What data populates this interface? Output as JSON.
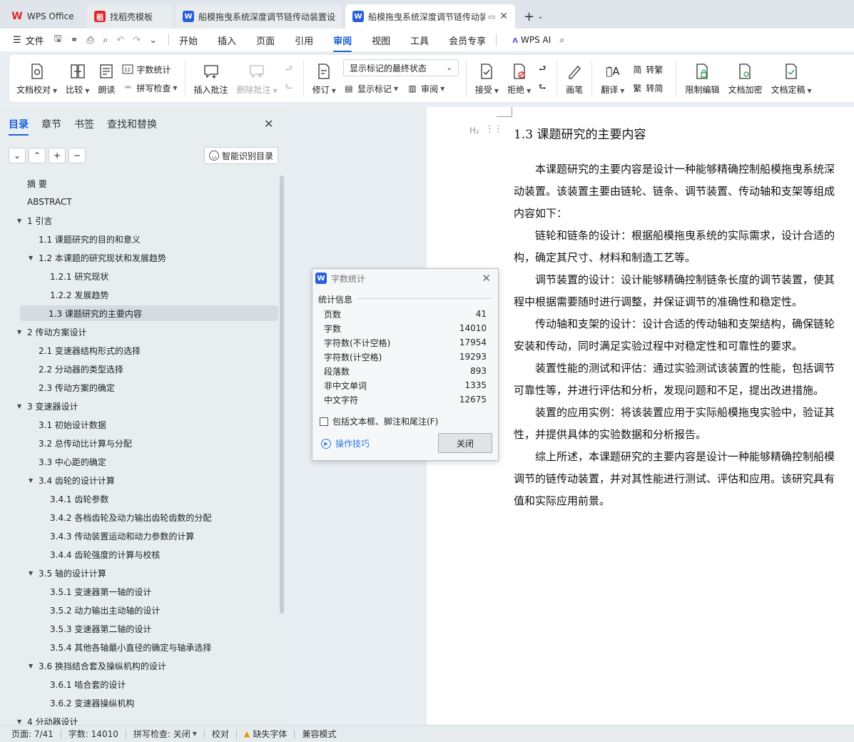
{
  "tabs": [
    {
      "label": "WPS Office"
    },
    {
      "label": "找稻壳模板"
    },
    {
      "label": "船模拖曳系统深度调节链传动装置设计"
    },
    {
      "label": "船模拖曳系统深度调节链传动装"
    }
  ],
  "menu": {
    "file": "文件",
    "nav": [
      "开始",
      "插入",
      "页面",
      "引用",
      "审阅",
      "视图",
      "工具",
      "会员专享"
    ],
    "ai": "WPS AI"
  },
  "ribbon": {
    "proof": "文档校对",
    "compare": "比较",
    "read": "朗读",
    "wordcount": "字数统计",
    "spell": "拼写检查",
    "insert_comment": "插入批注",
    "delete_comment": "删除批注",
    "revise": "修订",
    "markup_combo": "显示标记的最终状态",
    "show_markup": "显示标记",
    "review": "审阅",
    "accept": "接受",
    "reject": "拒绝",
    "pen": "画笔",
    "translate": "翻译",
    "to_trad": "转繁",
    "to_simp": "转简",
    "restrict": "限制编辑",
    "encrypt": "文档加密",
    "finalize": "文档定稿"
  },
  "navpane": {
    "tabs": [
      "目录",
      "章节",
      "书签",
      "查找和替换"
    ],
    "smart_toc": "智能识别目录",
    "toc": [
      {
        "label": "摘 要",
        "level": 0,
        "arrow": false
      },
      {
        "label": "ABSTRACT",
        "level": 0,
        "arrow": false
      },
      {
        "label": "1 引言",
        "level": 0,
        "arrow": true
      },
      {
        "label": "1.1 课题研究的目的和意义",
        "level": 1,
        "arrow": false
      },
      {
        "label": "1.2 本课题的研究现状和发展趋势",
        "level": 1,
        "arrow": true
      },
      {
        "label": "1.2.1 研究现状",
        "level": 2,
        "arrow": false
      },
      {
        "label": "1.2.2 发展趋势",
        "level": 2,
        "arrow": false
      },
      {
        "label": "1.3 课题研究的主要内容",
        "level": 1,
        "arrow": false,
        "selected": true
      },
      {
        "label": "2 传动方案设计",
        "level": 0,
        "arrow": true
      },
      {
        "label": "2.1 变速器结构形式的选择",
        "level": 1,
        "arrow": false
      },
      {
        "label": "2.2 分动器的类型选择",
        "level": 1,
        "arrow": false
      },
      {
        "label": "2.3 传动方案的确定",
        "level": 1,
        "arrow": false
      },
      {
        "label": "3 变速器设计",
        "level": 0,
        "arrow": true
      },
      {
        "label": "3.1 初始设计数据",
        "level": 1,
        "arrow": false
      },
      {
        "label": "3.2 总传动比计算与分配",
        "level": 1,
        "arrow": false
      },
      {
        "label": "3.3 中心距的确定",
        "level": 1,
        "arrow": false
      },
      {
        "label": "3.4 齿轮的设计计算",
        "level": 1,
        "arrow": true
      },
      {
        "label": "3.4.1 齿轮参数",
        "level": 2,
        "arrow": false
      },
      {
        "label": "3.4.2 各档齿轮及动力输出齿轮齿数的分配",
        "level": 2,
        "arrow": false
      },
      {
        "label": "3.4.3 传动装置运动和动力参数的计算",
        "level": 2,
        "arrow": false
      },
      {
        "label": "3.4.4 齿轮强度的计算与校核",
        "level": 2,
        "arrow": false
      },
      {
        "label": "3.5 轴的设计计算",
        "level": 1,
        "arrow": true
      },
      {
        "label": "3.5.1 变速器第一轴的设计",
        "level": 2,
        "arrow": false
      },
      {
        "label": "3.5.2 动力输出主动轴的设计",
        "level": 2,
        "arrow": false
      },
      {
        "label": "3.5.3 变速器第二轴的设计",
        "level": 2,
        "arrow": false
      },
      {
        "label": "3.5.4 其他各轴最小直径的确定与轴承选择",
        "level": 2,
        "arrow": false
      },
      {
        "label": "3.6 换挡结合套及操纵机构的设计",
        "level": 1,
        "arrow": true
      },
      {
        "label": "3.6.1 啮合套的设计",
        "level": 2,
        "arrow": false
      },
      {
        "label": "3.6.2 变速器操纵机构",
        "level": 2,
        "arrow": false
      },
      {
        "label": "4 分动器设计",
        "level": 0,
        "arrow": true
      }
    ]
  },
  "document": {
    "heading_marker": "H₂",
    "heading": "1.3 课题研究的主要内容",
    "paragraphs": [
      {
        "text": "本课题研究的主要内容是设计一种能够精确控制船模拖曳系统深",
        "indent": true
      },
      {
        "text": "动装置。该装置主要由链轮、链条、调节装置、传动轴和支架等组成",
        "indent": false
      },
      {
        "text": "内容如下：",
        "indent": false
      },
      {
        "text": "链轮和链条的设计：根据船模拖曳系统的实际需求，设计合适的",
        "indent": true
      },
      {
        "text": "构，确定其尺寸、材料和制造工艺等。",
        "indent": false
      },
      {
        "text": "调节装置的设计：设计能够精确控制链条长度的调节装置，使其",
        "indent": true
      },
      {
        "text": "程中根据需要随时进行调整，并保证调节的准确性和稳定性。",
        "indent": false
      },
      {
        "text": "传动轴和支架的设计：设计合适的传动轴和支架结构，确保链轮",
        "indent": true
      },
      {
        "text": "安装和传动，同时满足实验过程中对稳定性和可靠性的要求。",
        "indent": false
      },
      {
        "text": "装置性能的测试和评估：通过实验测试该装置的性能，包括调节",
        "indent": true
      },
      {
        "text": "可靠性等，并进行评估和分析，发现问题和不足，提出改进措施。",
        "indent": false
      },
      {
        "text": "装置的应用实例：将该装置应用于实际船模拖曳实验中，验证其",
        "indent": true
      },
      {
        "text": "性，并提供具体的实验数据和分析报告。",
        "indent": false
      },
      {
        "text": "综上所述，本课题研究的主要内容是设计一种能够精确控制船模",
        "indent": true
      },
      {
        "text": "调节的链传动装置，并对其性能进行测试、评估和应用。该研究具有",
        "indent": false
      },
      {
        "text": "值和实际应用前景。",
        "indent": false
      }
    ]
  },
  "dialog": {
    "title": "字数统计",
    "section": "统计信息",
    "stats": [
      {
        "label": "页数",
        "value": "41"
      },
      {
        "label": "字数",
        "value": "14010"
      },
      {
        "label": "字符数(不计空格)",
        "value": "17954"
      },
      {
        "label": "字符数(计空格)",
        "value": "19293"
      },
      {
        "label": "段落数",
        "value": "893"
      },
      {
        "label": "非中文单词",
        "value": "1335"
      },
      {
        "label": "中文字符",
        "value": "12675"
      }
    ],
    "checkbox": "包括文本框、脚注和尾注(F)",
    "tips": "操作技巧",
    "close": "关闭"
  },
  "status": {
    "page": "页面: 7/41",
    "words": "字数: 14010",
    "spell": "拼写检查: 关闭",
    "proof": "校对",
    "missing_font": "缺失字体",
    "compat": "兼容模式"
  },
  "colors": {
    "accent": "#1a5fd6",
    "wps_red": "#e0262b",
    "doc_blue": "#2b5fd9"
  }
}
